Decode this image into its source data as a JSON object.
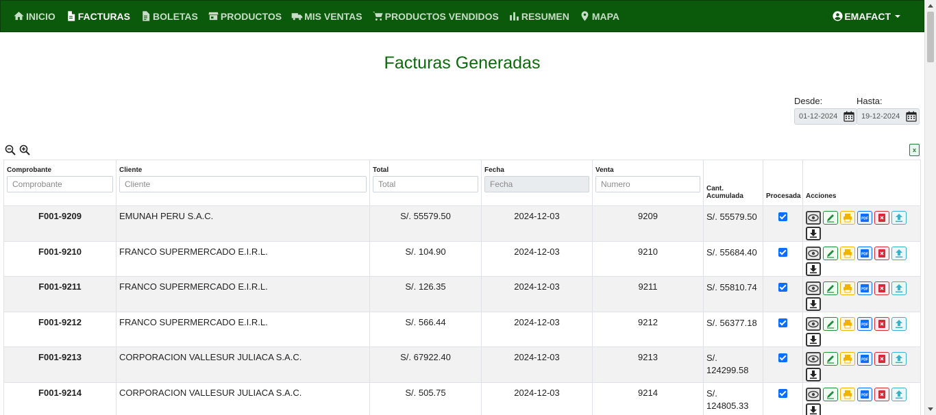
{
  "nav": {
    "items": [
      {
        "label": "INICIO",
        "icon": "home-icon",
        "active": false
      },
      {
        "label": "FACTURAS",
        "icon": "file-icon",
        "active": true
      },
      {
        "label": "BOLETAS",
        "icon": "document-icon",
        "active": false
      },
      {
        "label": "PRODUCTOS",
        "icon": "store-icon",
        "active": false
      },
      {
        "label": "MIS VENTAS",
        "icon": "truck-icon",
        "active": false
      },
      {
        "label": "PRODUCTOS VENDIDOS",
        "icon": "cart-icon",
        "active": false
      },
      {
        "label": "RESUMEN",
        "icon": "bar-chart-icon",
        "active": false
      },
      {
        "label": "MAPA",
        "icon": "map-pin-icon",
        "active": false
      }
    ],
    "user": "EMAFACT"
  },
  "page": {
    "title": "Facturas Generadas"
  },
  "filters": {
    "desde_label": "Desde:",
    "desde_value": "01-12-2024",
    "hasta_label": "Hasta:",
    "hasta_value": "19-12-2024"
  },
  "table": {
    "headers": {
      "comprobante": "Comprobante",
      "cliente": "Cliente",
      "total": "Total",
      "fecha": "Fecha",
      "venta": "Venta",
      "acumulada": "Cant. Acumulada",
      "procesada": "Procesada",
      "acciones": "Acciones"
    },
    "placeholders": {
      "comprobante": "Comprobante",
      "cliente": "Cliente",
      "total": "Total",
      "fecha": "Fecha",
      "venta": "Numero"
    },
    "rows": [
      {
        "comprobante": "F001-9209",
        "cliente": "EMUNAH PERU S.A.C.",
        "total": "S/. 55579.50",
        "fecha": "2024-12-03",
        "venta": "9209",
        "acumulada": "S/. 55579.50",
        "procesada": true
      },
      {
        "comprobante": "F001-9210",
        "cliente": "FRANCO SUPERMERCADO E.I.R.L.",
        "total": "S/. 104.90",
        "fecha": "2024-12-03",
        "venta": "9210",
        "acumulada": "S/. 55684.40",
        "procesada": true
      },
      {
        "comprobante": "F001-9211",
        "cliente": "FRANCO SUPERMERCADO E.I.R.L.",
        "total": "S/. 126.35",
        "fecha": "2024-12-03",
        "venta": "9211",
        "acumulada": "S/. 55810.74",
        "procesada": true
      },
      {
        "comprobante": "F001-9212",
        "cliente": "FRANCO SUPERMERCADO E.I.R.L.",
        "total": "S/. 566.44",
        "fecha": "2024-12-03",
        "venta": "9212",
        "acumulada": "S/. 56377.18",
        "procesada": true
      },
      {
        "comprobante": "F001-9213",
        "cliente": "CORPORACION VALLESUR JULIACA S.A.C.",
        "total": "S/. 67922.40",
        "fecha": "2024-12-03",
        "venta": "9213",
        "acumulada": "S/. 124299.58",
        "procesada": true
      },
      {
        "comprobante": "F001-9214",
        "cliente": "CORPORACION VALLESUR JULIACA S.A.C.",
        "total": "S/. 505.75",
        "fecha": "2024-12-03",
        "venta": "9214",
        "acumulada": "S/. 124805.33",
        "procesada": true
      }
    ],
    "actions": [
      {
        "name": "view-icon",
        "cls": "b-view"
      },
      {
        "name": "edit-icon",
        "cls": "b-edit"
      },
      {
        "name": "print-icon",
        "cls": "b-print"
      },
      {
        "name": "pdf-icon",
        "cls": "b-pdf"
      },
      {
        "name": "delete-icon",
        "cls": "b-del"
      },
      {
        "name": "upload-icon",
        "cls": "b-up"
      },
      {
        "name": "download-icon",
        "cls": "b-down"
      }
    ]
  },
  "colors": {
    "navbar": "#0b5a0b",
    "title": "#0b6b0b",
    "accent": "#0d6efd"
  }
}
